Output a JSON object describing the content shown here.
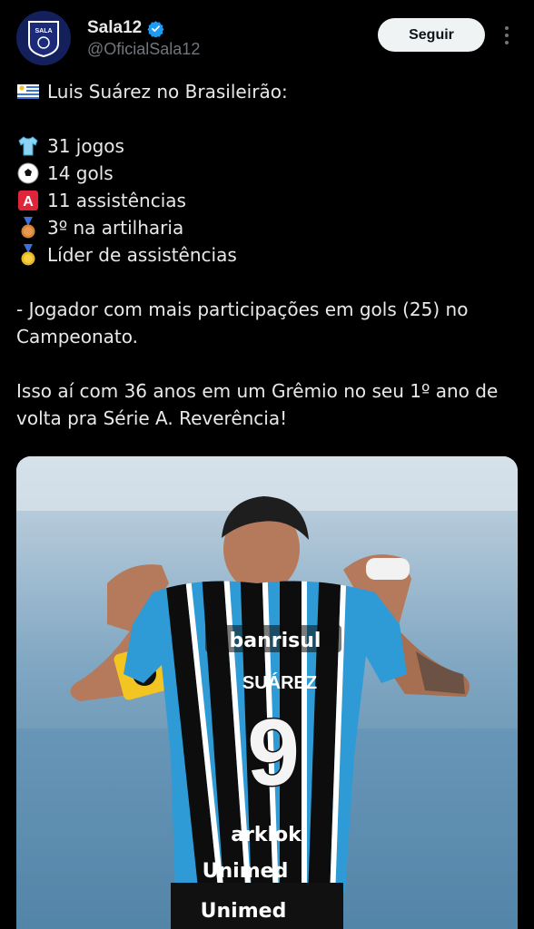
{
  "account": {
    "display_name": "Sala12",
    "handle": "@OficialSala12",
    "avatar_text": "SALA"
  },
  "actions": {
    "follow_label": "Seguir"
  },
  "tweet": {
    "headline": "Luis Suárez no Brasileirão:",
    "stats": [
      {
        "icon": "shirt-emoji",
        "text": "31 jogos"
      },
      {
        "icon": "soccer-ball-emoji",
        "text": "14 gols"
      },
      {
        "icon": "a-button-emoji",
        "text": "11 assistências"
      },
      {
        "icon": "bronze-medal-emoji",
        "text": "3º na artilharia"
      },
      {
        "icon": "gold-medal-emoji",
        "text": "Líder de assistências"
      }
    ],
    "paragraph1_line1": "- Jogador com mais participações em gols (25) no",
    "paragraph1_line2": "Campeonato.",
    "paragraph2_line1": "Isso aí com 36 anos em um Grêmio no seu 1º ano de",
    "paragraph2_line2": "volta pra Série A. Reverência!"
  },
  "media": {
    "description_icon": "photo",
    "jersey_sponsor": "banrisul",
    "jersey_name": "SUÁREZ",
    "jersey_number": "9",
    "jersey_sponsor_2": "arklok",
    "jersey_sponsor_3": "Unimed",
    "jersey_sponsor_4": "Unimed"
  },
  "colors": {
    "background": "#000000",
    "text": "#e7e9ea",
    "muted": "#71767b",
    "verified": "#1d9bf0",
    "follow_bg": "#eff3f4",
    "gremio_blue": "#2f9bd6",
    "gremio_black": "#0d0d0d"
  }
}
